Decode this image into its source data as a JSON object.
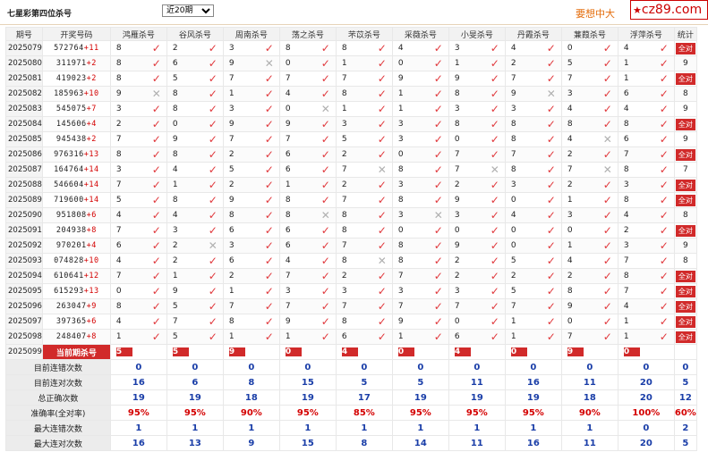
{
  "header": {
    "title": "七星彩第四位杀号",
    "period_selected": "近20期",
    "promo_text": "要想中大",
    "logo_text": "cz89.com",
    "logo_star": "★"
  },
  "columns": {
    "issue": "期号",
    "draw": "开奖号码",
    "experts": [
      "鸿雁杀号",
      "谷风杀号",
      "周南杀号",
      "荡之杀号",
      "芣苡杀号",
      "采薇杀号",
      "小旻杀号",
      "丹霞杀号",
      "蒹葭杀号",
      "浮萍杀号"
    ],
    "stats": "统计"
  },
  "rows": [
    {
      "issue": "2025079",
      "draw": "572764",
      "sum": "+11",
      "picks": [
        "8",
        "2",
        "3",
        "8",
        "8",
        "4",
        "3",
        "4",
        "0",
        "4"
      ],
      "ok": [
        1,
        1,
        1,
        1,
        1,
        1,
        1,
        1,
        1,
        1
      ],
      "stat": "全对"
    },
    {
      "issue": "2025080",
      "draw": "311971",
      "sum": "+2",
      "picks": [
        "8",
        "6",
        "9",
        "0",
        "1",
        "0",
        "1",
        "2",
        "5",
        "1"
      ],
      "ok": [
        1,
        1,
        0,
        1,
        1,
        1,
        1,
        1,
        1,
        1
      ],
      "stat": "9"
    },
    {
      "issue": "2025081",
      "draw": "419023",
      "sum": "+2",
      "picks": [
        "8",
        "5",
        "7",
        "7",
        "7",
        "9",
        "9",
        "7",
        "7",
        "1"
      ],
      "ok": [
        1,
        1,
        1,
        1,
        1,
        1,
        1,
        1,
        1,
        1
      ],
      "stat": "全对"
    },
    {
      "issue": "2025082",
      "draw": "185963",
      "sum": "+10",
      "picks": [
        "9",
        "8",
        "1",
        "4",
        "8",
        "1",
        "8",
        "9",
        "3",
        "6"
      ],
      "ok": [
        0,
        1,
        1,
        1,
        1,
        1,
        1,
        0,
        1,
        1
      ],
      "stat": "8"
    },
    {
      "issue": "2025083",
      "draw": "545075",
      "sum": "+7",
      "picks": [
        "3",
        "8",
        "3",
        "0",
        "1",
        "1",
        "3",
        "3",
        "4",
        "4"
      ],
      "ok": [
        1,
        1,
        1,
        0,
        1,
        1,
        1,
        1,
        1,
        1
      ],
      "stat": "9"
    },
    {
      "issue": "2025084",
      "draw": "145606",
      "sum": "+4",
      "picks": [
        "2",
        "0",
        "9",
        "9",
        "3",
        "3",
        "8",
        "8",
        "8",
        "8"
      ],
      "ok": [
        1,
        1,
        1,
        1,
        1,
        1,
        1,
        1,
        1,
        1
      ],
      "stat": "全对"
    },
    {
      "issue": "2025085",
      "draw": "945438",
      "sum": "+2",
      "picks": [
        "7",
        "9",
        "7",
        "7",
        "5",
        "3",
        "0",
        "8",
        "4",
        "6"
      ],
      "ok": [
        1,
        1,
        1,
        1,
        1,
        1,
        1,
        1,
        0,
        1
      ],
      "stat": "9"
    },
    {
      "issue": "2025086",
      "draw": "976316",
      "sum": "+13",
      "picks": [
        "8",
        "8",
        "2",
        "6",
        "2",
        "0",
        "7",
        "7",
        "2",
        "7"
      ],
      "ok": [
        1,
        1,
        1,
        1,
        1,
        1,
        1,
        1,
        1,
        1
      ],
      "stat": "全对"
    },
    {
      "issue": "2025087",
      "draw": "164764",
      "sum": "+14",
      "picks": [
        "3",
        "4",
        "5",
        "6",
        "7",
        "8",
        "7",
        "8",
        "7",
        "8"
      ],
      "ok": [
        1,
        1,
        1,
        1,
        0,
        1,
        0,
        1,
        0,
        1
      ],
      "stat": "7"
    },
    {
      "issue": "2025088",
      "draw": "546604",
      "sum": "+14",
      "picks": [
        "7",
        "1",
        "2",
        "1",
        "2",
        "3",
        "2",
        "3",
        "2",
        "3"
      ],
      "ok": [
        1,
        1,
        1,
        1,
        1,
        1,
        1,
        1,
        1,
        1
      ],
      "stat": "全对"
    },
    {
      "issue": "2025089",
      "draw": "719600",
      "sum": "+14",
      "picks": [
        "5",
        "8",
        "9",
        "8",
        "7",
        "8",
        "9",
        "0",
        "1",
        "8"
      ],
      "ok": [
        1,
        1,
        1,
        1,
        1,
        1,
        1,
        1,
        1,
        1
      ],
      "stat": "全对"
    },
    {
      "issue": "2025090",
      "draw": "951808",
      "sum": "+6",
      "picks": [
        "4",
        "4",
        "8",
        "8",
        "8",
        "3",
        "3",
        "4",
        "3",
        "4"
      ],
      "ok": [
        1,
        1,
        1,
        0,
        1,
        0,
        1,
        1,
        1,
        1
      ],
      "stat": "8"
    },
    {
      "issue": "2025091",
      "draw": "204938",
      "sum": "+8",
      "picks": [
        "7",
        "3",
        "6",
        "6",
        "8",
        "0",
        "0",
        "0",
        "0",
        "2"
      ],
      "ok": [
        1,
        1,
        1,
        1,
        1,
        1,
        1,
        1,
        1,
        1
      ],
      "stat": "全对"
    },
    {
      "issue": "2025092",
      "draw": "970201",
      "sum": "+4",
      "picks": [
        "6",
        "2",
        "3",
        "6",
        "7",
        "8",
        "9",
        "0",
        "1",
        "3"
      ],
      "ok": [
        1,
        0,
        1,
        1,
        1,
        1,
        1,
        1,
        1,
        1
      ],
      "stat": "9"
    },
    {
      "issue": "2025093",
      "draw": "074828",
      "sum": "+10",
      "picks": [
        "4",
        "2",
        "6",
        "4",
        "8",
        "8",
        "2",
        "5",
        "4",
        "7"
      ],
      "ok": [
        1,
        1,
        1,
        1,
        0,
        1,
        1,
        1,
        1,
        1
      ],
      "stat": "8"
    },
    {
      "issue": "2025094",
      "draw": "610641",
      "sum": "+12",
      "picks": [
        "7",
        "1",
        "2",
        "7",
        "2",
        "7",
        "2",
        "2",
        "2",
        "8"
      ],
      "ok": [
        1,
        1,
        1,
        1,
        1,
        1,
        1,
        1,
        1,
        1
      ],
      "stat": "全对"
    },
    {
      "issue": "2025095",
      "draw": "615293",
      "sum": "+13",
      "picks": [
        "0",
        "9",
        "1",
        "3",
        "3",
        "3",
        "3",
        "5",
        "8",
        "7"
      ],
      "ok": [
        1,
        1,
        1,
        1,
        1,
        1,
        1,
        1,
        1,
        1
      ],
      "stat": "全对"
    },
    {
      "issue": "2025096",
      "draw": "263047",
      "sum": "+9",
      "picks": [
        "8",
        "5",
        "7",
        "7",
        "7",
        "7",
        "7",
        "7",
        "9",
        "4"
      ],
      "ok": [
        1,
        1,
        1,
        1,
        1,
        1,
        1,
        1,
        1,
        1
      ],
      "stat": "全对"
    },
    {
      "issue": "2025097",
      "draw": "397365",
      "sum": "+6",
      "picks": [
        "4",
        "7",
        "8",
        "9",
        "8",
        "9",
        "0",
        "1",
        "0",
        "1"
      ],
      "ok": [
        1,
        1,
        1,
        1,
        1,
        1,
        1,
        1,
        1,
        1
      ],
      "stat": "全对"
    },
    {
      "issue": "2025098",
      "draw": "248407",
      "sum": "+8",
      "picks": [
        "1",
        "5",
        "1",
        "1",
        "6",
        "1",
        "6",
        "1",
        "7",
        "1"
      ],
      "ok": [
        1,
        1,
        1,
        1,
        1,
        1,
        1,
        1,
        1,
        1
      ],
      "stat": "全对"
    }
  ],
  "current": {
    "issue": "2025099",
    "label": "当前期杀号",
    "picks": [
      "5",
      "5",
      "9",
      "0",
      "4",
      "0",
      "4",
      "0",
      "9",
      "0"
    ]
  },
  "summary": [
    {
      "label": "目前连错次数",
      "values": [
        "0",
        "0",
        "0",
        "0",
        "0",
        "0",
        "0",
        "0",
        "0",
        "0",
        "0"
      ],
      "style": "sval"
    },
    {
      "label": "目前连对次数",
      "values": [
        "16",
        "6",
        "8",
        "15",
        "5",
        "5",
        "11",
        "16",
        "11",
        "20",
        "5"
      ],
      "style": "sval"
    },
    {
      "label": "总正确次数",
      "values": [
        "19",
        "19",
        "18",
        "19",
        "17",
        "19",
        "19",
        "19",
        "18",
        "20",
        "12"
      ],
      "style": "sval"
    },
    {
      "label": "准确率(全对率)",
      "values": [
        "95%",
        "95%",
        "90%",
        "95%",
        "85%",
        "95%",
        "95%",
        "95%",
        "90%",
        "100%",
        "60%"
      ],
      "style": "rate"
    },
    {
      "label": "最大连错次数",
      "values": [
        "1",
        "1",
        "1",
        "1",
        "1",
        "1",
        "1",
        "1",
        "1",
        "0",
        "2"
      ],
      "style": "sval"
    },
    {
      "label": "最大连对次数",
      "values": [
        "16",
        "13",
        "9",
        "15",
        "8",
        "14",
        "11",
        "16",
        "11",
        "20",
        "5"
      ],
      "style": "sval"
    }
  ],
  "symbols": {
    "ok": "✓",
    "bad": "✕"
  },
  "colors": {
    "accent": "#d12a2a",
    "promo": "#e46c0a",
    "stat_blue": "#1a3ea8"
  }
}
